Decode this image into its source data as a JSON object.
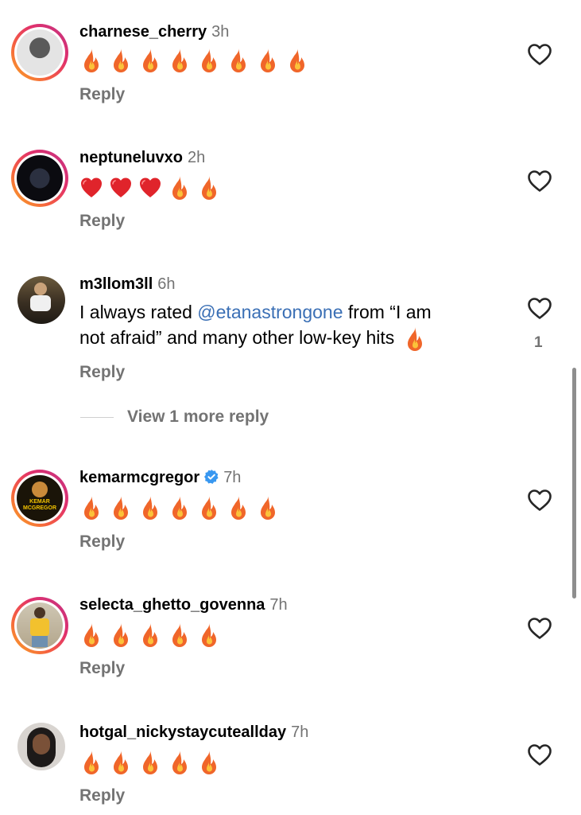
{
  "comments": [
    {
      "username": "charnese_cherry",
      "time": "3h",
      "reply_label": "Reply",
      "emojis": [
        "fire",
        "fire",
        "fire",
        "fire",
        "fire",
        "fire",
        "fire",
        "fire"
      ],
      "story_ring": true,
      "avatar_colors": [
        "#d9d9d9",
        "#4a4a4a"
      ]
    },
    {
      "username": "neptuneluvxo",
      "time": "2h",
      "reply_label": "Reply",
      "emojis": [
        "heart",
        "heart",
        "heart",
        "fire",
        "fire"
      ],
      "story_ring": true,
      "avatar_colors": [
        "#0b0b10",
        "#2b3040"
      ]
    },
    {
      "username": "m3llom3ll",
      "time": "6h",
      "reply_label": "Reply",
      "text_before": "I always rated ",
      "mention": "@etanastrongone",
      "text_after": " from “I am",
      "text_line2": "not afraid” and many other low-key hits",
      "like_count": "1",
      "view_more": "View 1 more reply",
      "story_ring": false
    },
    {
      "username": "kemarmcgregor",
      "time": "7h",
      "reply_label": "Reply",
      "verified": true,
      "emojis": [
        "fire",
        "fire",
        "fire",
        "fire",
        "fire",
        "fire",
        "fire"
      ],
      "story_ring": true,
      "avatar_text": "KEMAR MCGREGOR"
    },
    {
      "username": "selecta_ghetto_govenna",
      "time": "7h",
      "reply_label": "Reply",
      "emojis": [
        "fire",
        "fire",
        "fire",
        "fire",
        "fire"
      ],
      "story_ring": true
    },
    {
      "username": "hotgal_nickystaycuteallday",
      "time": "7h",
      "reply_label": "Reply",
      "emojis": [
        "fire",
        "fire",
        "fire",
        "fire",
        "fire"
      ],
      "story_ring": false
    }
  ],
  "colors": {
    "mention": "#3a6fb5",
    "muted": "#737373",
    "story_ring_start": "#f9a825",
    "story_ring_end": "#c13584",
    "verified": "#3897f0"
  }
}
